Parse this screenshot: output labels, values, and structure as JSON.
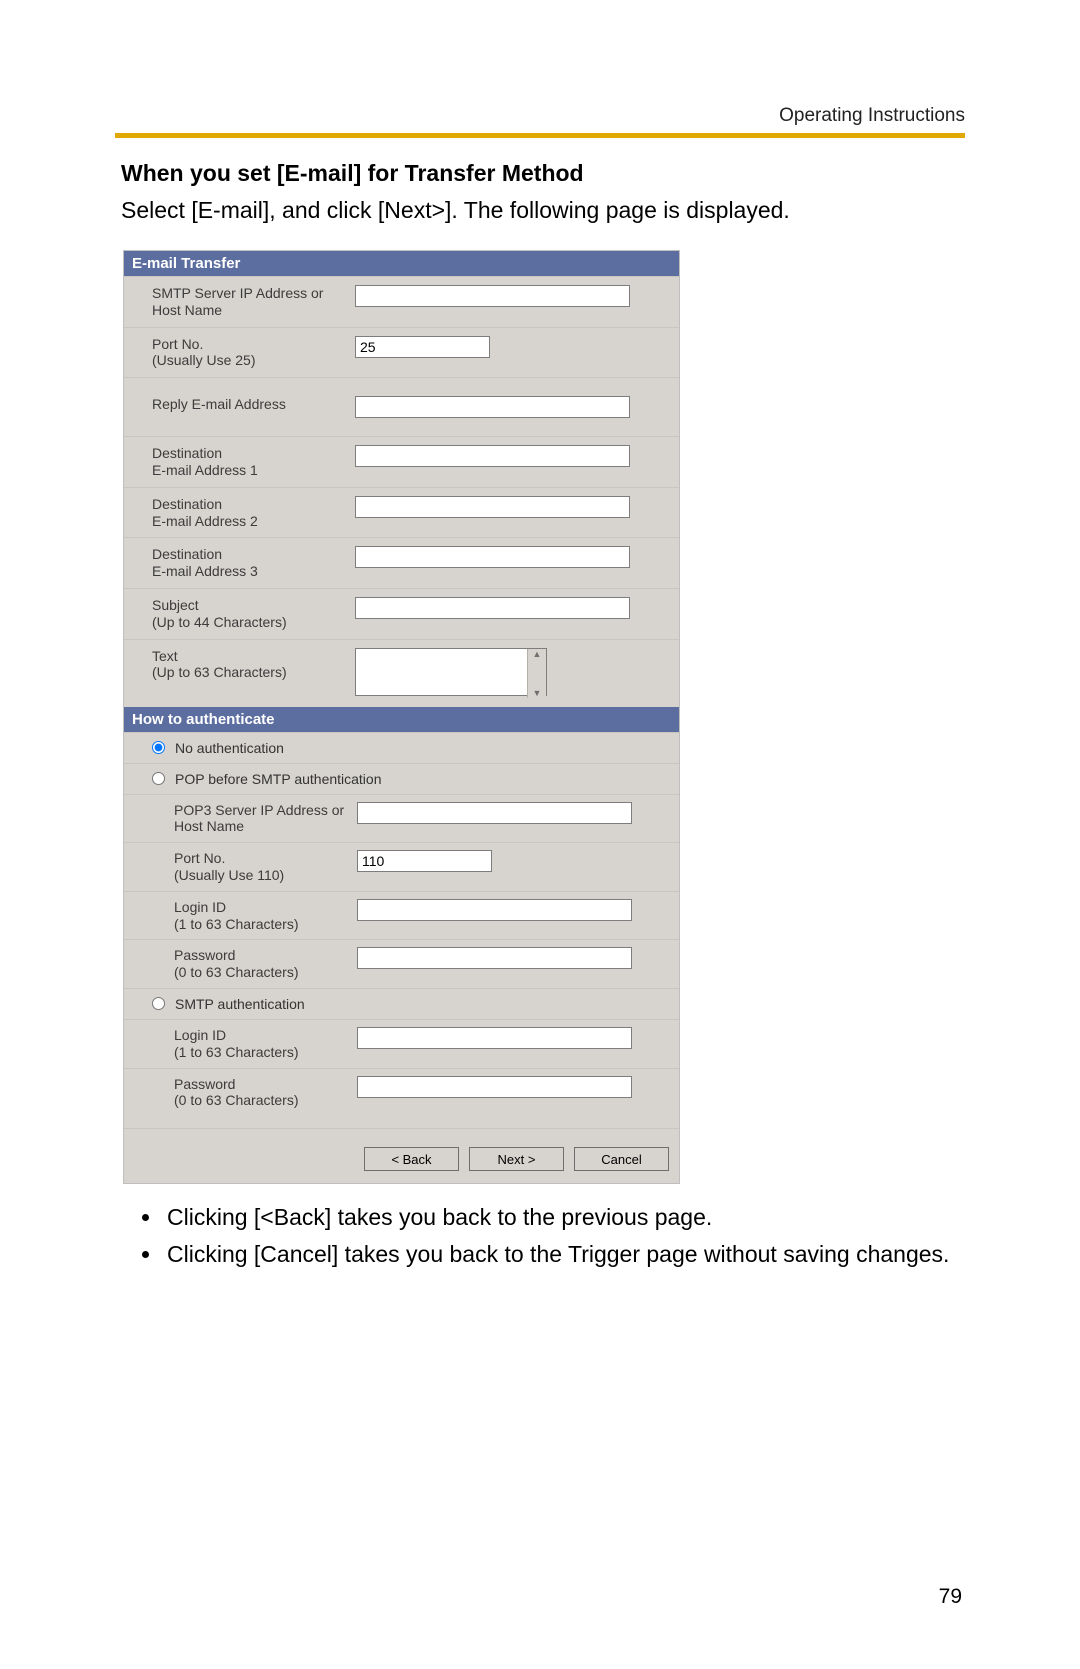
{
  "header_label": "Operating Instructions",
  "heading": "When you set [E-mail] for Transfer Method",
  "intro": "Select [E-mail], and click [Next>]. The following page is displayed.",
  "dialog": {
    "section1_title": "E-mail Transfer",
    "fields": {
      "smtp_label": "SMTP Server IP Address or Host Name",
      "smtp_value": "",
      "smtp_port_label": "Port No.\n(Usually Use 25)",
      "smtp_port_value": "25",
      "reply_label": "Reply E-mail Address",
      "reply_value": "",
      "dest1_label": "Destination\nE-mail Address 1",
      "dest1_value": "",
      "dest2_label": "Destination\nE-mail Address 2",
      "dest2_value": "",
      "dest3_label": "Destination\nE-mail Address 3",
      "dest3_value": "",
      "subject_label": "Subject\n(Up to 44 Characters)",
      "subject_value": "",
      "text_label": "Text\n(Up to 63 Characters)",
      "text_value": ""
    },
    "section2_title": "How to authenticate",
    "auth": {
      "opt_none": "No authentication",
      "opt_pop": "POP before SMTP authentication",
      "pop_server_label": "POP3 Server IP Address or Host Name",
      "pop_server_value": "",
      "pop_port_label": "Port No.\n(Usually Use 110)",
      "pop_port_value": "110",
      "pop_login_label": "Login ID\n(1 to 63 Characters)",
      "pop_login_value": "",
      "pop_pass_label": "Password\n(0 to 63 Characters)",
      "pop_pass_value": "",
      "opt_smtp": "SMTP authentication",
      "smtp_login_label": "Login ID\n(1 to 63 Characters)",
      "smtp_login_value": "",
      "smtp_pass_label": "Password\n(0 to 63 Characters)",
      "smtp_pass_value": ""
    },
    "buttons": {
      "back": "< Back",
      "next": "Next >",
      "cancel": "Cancel"
    }
  },
  "notes": [
    "Clicking [<Back] takes you back to the previous page.",
    "Clicking [Cancel] takes you back to the Trigger page without saving changes."
  ],
  "page_number": "79"
}
